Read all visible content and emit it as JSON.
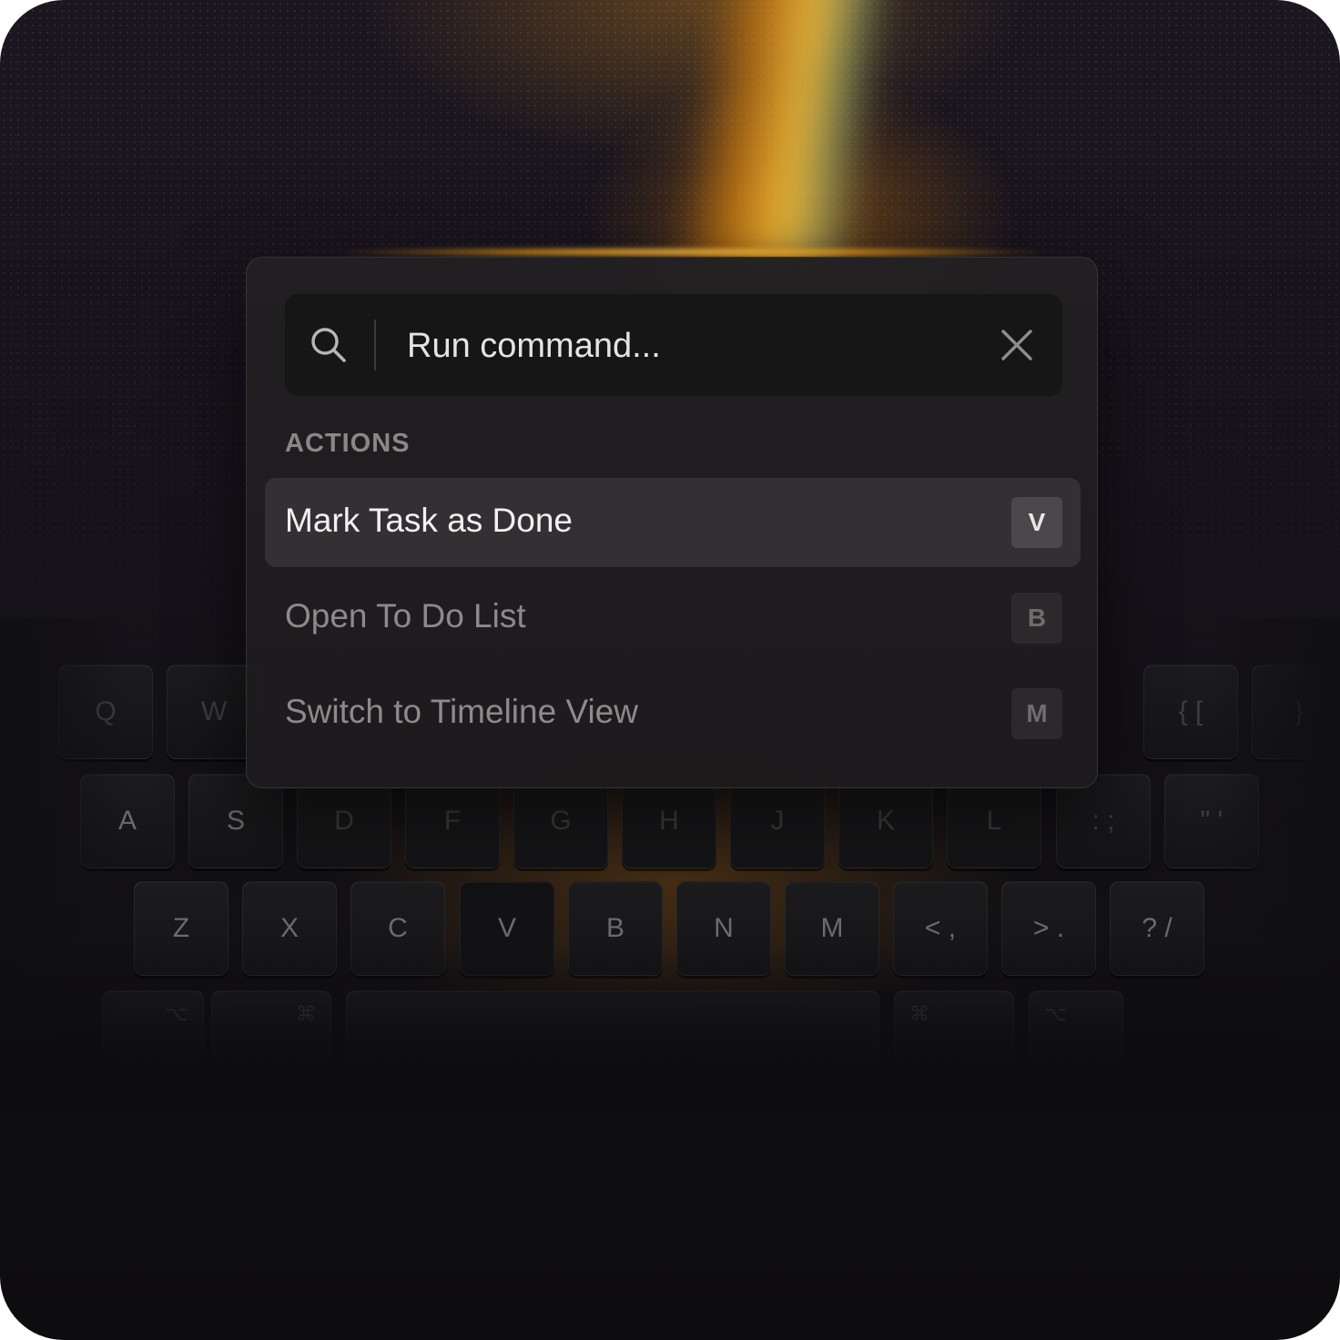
{
  "palette": {
    "search": {
      "placeholder": "Run command...",
      "value": ""
    },
    "section_title": "ACTIONS",
    "items": [
      {
        "label": "Mark Task as Done",
        "shortcut": "V",
        "selected": true
      },
      {
        "label": "Open To Do List",
        "shortcut": "B",
        "selected": false
      },
      {
        "label": "Switch to Timeline View",
        "shortcut": "M",
        "selected": false
      }
    ]
  },
  "keyboard": {
    "row_top": [
      "Q",
      "W",
      "{ [",
      "}"
    ],
    "row_home": [
      "A",
      "S",
      "D",
      "F",
      "G",
      "H",
      "J",
      "K",
      "L",
      ": ;",
      "\" '"
    ],
    "row_bottom": [
      "Z",
      "X",
      "C",
      "V",
      "B",
      "N",
      "M",
      "< ,",
      "> .",
      "? /"
    ],
    "row_mod": [
      "⌥",
      "⌘",
      "⌘",
      "⌥"
    ]
  },
  "colors": {
    "accent_glow": "#ffb020",
    "panel": "#222022",
    "selected_row": "#323032"
  }
}
